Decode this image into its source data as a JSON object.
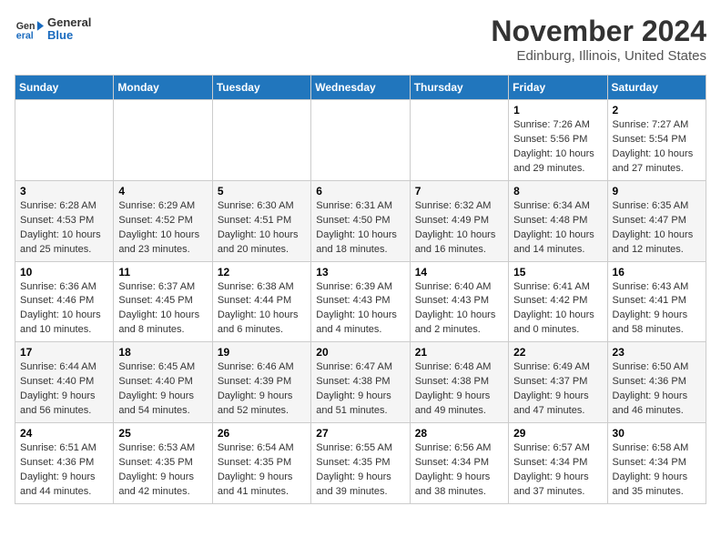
{
  "header": {
    "logo_general": "General",
    "logo_blue": "Blue",
    "month_title": "November 2024",
    "location": "Edinburg, Illinois, United States"
  },
  "weekdays": [
    "Sunday",
    "Monday",
    "Tuesday",
    "Wednesday",
    "Thursday",
    "Friday",
    "Saturday"
  ],
  "weeks": [
    [
      {
        "day": "",
        "info": ""
      },
      {
        "day": "",
        "info": ""
      },
      {
        "day": "",
        "info": ""
      },
      {
        "day": "",
        "info": ""
      },
      {
        "day": "",
        "info": ""
      },
      {
        "day": "1",
        "info": "Sunrise: 7:26 AM\nSunset: 5:56 PM\nDaylight: 10 hours and 29 minutes."
      },
      {
        "day": "2",
        "info": "Sunrise: 7:27 AM\nSunset: 5:54 PM\nDaylight: 10 hours and 27 minutes."
      }
    ],
    [
      {
        "day": "3",
        "info": "Sunrise: 6:28 AM\nSunset: 4:53 PM\nDaylight: 10 hours and 25 minutes."
      },
      {
        "day": "4",
        "info": "Sunrise: 6:29 AM\nSunset: 4:52 PM\nDaylight: 10 hours and 23 minutes."
      },
      {
        "day": "5",
        "info": "Sunrise: 6:30 AM\nSunset: 4:51 PM\nDaylight: 10 hours and 20 minutes."
      },
      {
        "day": "6",
        "info": "Sunrise: 6:31 AM\nSunset: 4:50 PM\nDaylight: 10 hours and 18 minutes."
      },
      {
        "day": "7",
        "info": "Sunrise: 6:32 AM\nSunset: 4:49 PM\nDaylight: 10 hours and 16 minutes."
      },
      {
        "day": "8",
        "info": "Sunrise: 6:34 AM\nSunset: 4:48 PM\nDaylight: 10 hours and 14 minutes."
      },
      {
        "day": "9",
        "info": "Sunrise: 6:35 AM\nSunset: 4:47 PM\nDaylight: 10 hours and 12 minutes."
      }
    ],
    [
      {
        "day": "10",
        "info": "Sunrise: 6:36 AM\nSunset: 4:46 PM\nDaylight: 10 hours and 10 minutes."
      },
      {
        "day": "11",
        "info": "Sunrise: 6:37 AM\nSunset: 4:45 PM\nDaylight: 10 hours and 8 minutes."
      },
      {
        "day": "12",
        "info": "Sunrise: 6:38 AM\nSunset: 4:44 PM\nDaylight: 10 hours and 6 minutes."
      },
      {
        "day": "13",
        "info": "Sunrise: 6:39 AM\nSunset: 4:43 PM\nDaylight: 10 hours and 4 minutes."
      },
      {
        "day": "14",
        "info": "Sunrise: 6:40 AM\nSunset: 4:43 PM\nDaylight: 10 hours and 2 minutes."
      },
      {
        "day": "15",
        "info": "Sunrise: 6:41 AM\nSunset: 4:42 PM\nDaylight: 10 hours and 0 minutes."
      },
      {
        "day": "16",
        "info": "Sunrise: 6:43 AM\nSunset: 4:41 PM\nDaylight: 9 hours and 58 minutes."
      }
    ],
    [
      {
        "day": "17",
        "info": "Sunrise: 6:44 AM\nSunset: 4:40 PM\nDaylight: 9 hours and 56 minutes."
      },
      {
        "day": "18",
        "info": "Sunrise: 6:45 AM\nSunset: 4:40 PM\nDaylight: 9 hours and 54 minutes."
      },
      {
        "day": "19",
        "info": "Sunrise: 6:46 AM\nSunset: 4:39 PM\nDaylight: 9 hours and 52 minutes."
      },
      {
        "day": "20",
        "info": "Sunrise: 6:47 AM\nSunset: 4:38 PM\nDaylight: 9 hours and 51 minutes."
      },
      {
        "day": "21",
        "info": "Sunrise: 6:48 AM\nSunset: 4:38 PM\nDaylight: 9 hours and 49 minutes."
      },
      {
        "day": "22",
        "info": "Sunrise: 6:49 AM\nSunset: 4:37 PM\nDaylight: 9 hours and 47 minutes."
      },
      {
        "day": "23",
        "info": "Sunrise: 6:50 AM\nSunset: 4:36 PM\nDaylight: 9 hours and 46 minutes."
      }
    ],
    [
      {
        "day": "24",
        "info": "Sunrise: 6:51 AM\nSunset: 4:36 PM\nDaylight: 9 hours and 44 minutes."
      },
      {
        "day": "25",
        "info": "Sunrise: 6:53 AM\nSunset: 4:35 PM\nDaylight: 9 hours and 42 minutes."
      },
      {
        "day": "26",
        "info": "Sunrise: 6:54 AM\nSunset: 4:35 PM\nDaylight: 9 hours and 41 minutes."
      },
      {
        "day": "27",
        "info": "Sunrise: 6:55 AM\nSunset: 4:35 PM\nDaylight: 9 hours and 39 minutes."
      },
      {
        "day": "28",
        "info": "Sunrise: 6:56 AM\nSunset: 4:34 PM\nDaylight: 9 hours and 38 minutes."
      },
      {
        "day": "29",
        "info": "Sunrise: 6:57 AM\nSunset: 4:34 PM\nDaylight: 9 hours and 37 minutes."
      },
      {
        "day": "30",
        "info": "Sunrise: 6:58 AM\nSunset: 4:34 PM\nDaylight: 9 hours and 35 minutes."
      }
    ]
  ]
}
